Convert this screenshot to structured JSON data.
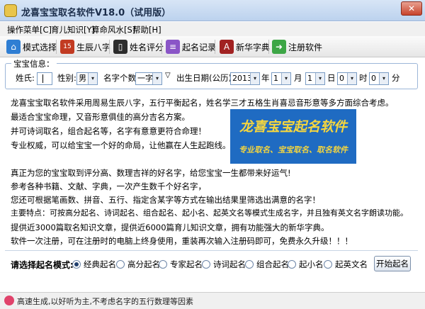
{
  "window": {
    "title": "龙喜宝宝取名软件V18.0（试用版）",
    "close_glyph": "✕"
  },
  "menu": [
    "操作菜单[C]",
    "育儿知识[Y]",
    "算命风水[S]",
    "帮助[H]"
  ],
  "toolbar": [
    {
      "label": "模式选择",
      "icon": "house-icon",
      "color": "#2f7ed3",
      "glyph": "⌂"
    },
    {
      "label": "生辰八字",
      "icon": "calendar-icon",
      "color": "#c23b22",
      "glyph": "15"
    },
    {
      "label": "姓名评分",
      "icon": "phone-icon",
      "color": "#2d2d2d",
      "glyph": "▯"
    },
    {
      "label": "起名记录",
      "icon": "notebook-icon",
      "color": "#8a55c7",
      "glyph": "≡"
    },
    {
      "label": "新华字典",
      "icon": "dictionary-icon",
      "color": "#a12222",
      "glyph": "A"
    },
    {
      "label": "注册软件",
      "icon": "register-icon",
      "color": "#3da646",
      "glyph": "➜"
    }
  ],
  "info": {
    "legend": "宝宝信息：",
    "surname_label": "姓氏:",
    "surname_value": "",
    "gender_label": "性别:",
    "gender_value": "男",
    "count_label": "名字个数:",
    "count_value": "一字",
    "birth_label": "出生日期(公历):",
    "year": "2013",
    "year_unit": "年",
    "month": "1",
    "month_unit": "月",
    "day": "1",
    "day_unit": "日",
    "hour": "0",
    "hour_unit": "时",
    "minute": "0",
    "minute_unit": "分",
    "dropdown_glyph": "▾",
    "filter_glyph": "▽"
  },
  "intro": [
    "龙喜宝宝取名软件采用周易生辰八字，五行平衡起名，姓名学三才五格生肖喜忌音形意等多方面综合考虑。",
    "最适合宝宝命理，又音形意俱佳的高分吉名方案。",
    "并可诗词取名，组合起名等，名字有意意更符合命理！",
    "专业权威，可以给宝宝一个好的命局，让他赢在人生起跑线。"
  ],
  "banner": {
    "title": "龙喜宝宝起名软件",
    "subtitle": "专业取名、宝宝取名、取名软件"
  },
  "features": [
    "真正为您的宝宝取到评分高、数理吉祥的好名字，给您宝宝一生都带来好运气!",
    "参考各种书籍、文献、字典，一次产生数千个好名字，",
    "您还可根据笔画数、拼音、五行、指定含某字等方式在输出结果里筛选出满意的名字！",
    "主要特点：可按高分起名、诗词起名、组合起名、起小名、起英文名等模式生成名字，并且独有英文名字朗读功能。",
    "提供近3000篇取名知识文章，提供近6000篇育儿知识文章，拥有功能强大的新华字典。",
    "软件一次注册，可在注册时的电脑上终身使用，重装再次输入注册码即可，免费永久升级！！！"
  ],
  "mode": {
    "label": "请选择起名模式:",
    "options": [
      "经典起名",
      "高分起名",
      "专家起名",
      "诗词起名",
      "组合起名",
      "起小名",
      "起英文名"
    ],
    "selected": "经典起名",
    "start_button": "开始起名"
  },
  "status": {
    "text": "高速生成,以好听为主,不考虑名字的五行数理等因素",
    "icon": "heart-icon"
  }
}
